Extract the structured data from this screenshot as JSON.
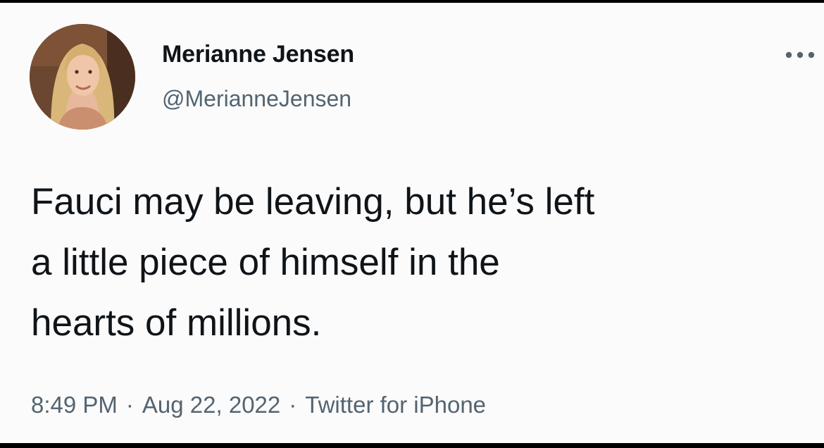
{
  "author": {
    "display_name": "Merianne Jensen",
    "handle": "@MerianneJensen"
  },
  "tweet": {
    "text_lines": [
      "Fauci may be leaving, but he’s left",
      "a little piece of himself in the",
      "hearts of millions."
    ]
  },
  "meta": {
    "time": "8:49 PM",
    "separator": "·",
    "date": "Aug 22, 2022",
    "source": "Twitter for iPhone"
  },
  "icons": {
    "more": "more-options-icon",
    "avatar": "avatar"
  },
  "colors": {
    "primary_text": "#0f1419",
    "secondary_text": "#536471",
    "background": "#fbfbfb"
  }
}
